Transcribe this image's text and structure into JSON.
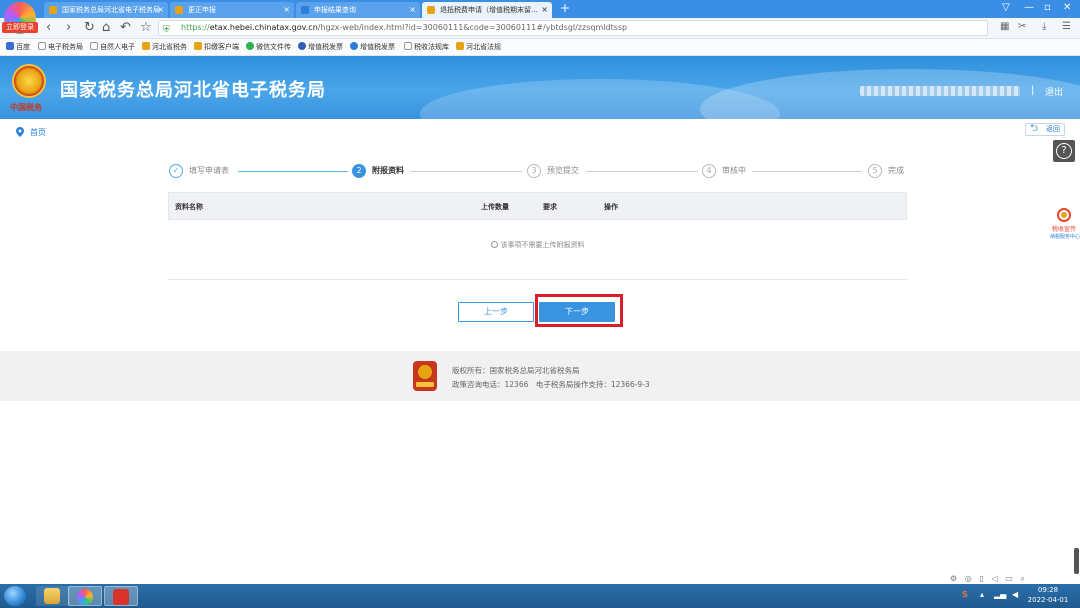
{
  "browser": {
    "badge": "立即登录",
    "tabs": [
      {
        "title": "国家税务总局河北省电子税务局",
        "active": false
      },
      {
        "title": "更正申报",
        "active": false
      },
      {
        "title": "申报结果查询",
        "active": false
      },
      {
        "title": "退抵税费申请（增值税期末留…",
        "active": true
      }
    ],
    "url_scheme": "https://",
    "url_host": "etax.hebei.chinatax.gov.cn",
    "url_path": "/hgzx-web/index.html?id=30060111&code=30060111#/ybtdsgl/zzsqmldtssp",
    "bookmarks": [
      "百度",
      "电子税务局",
      "自然人电子",
      "河北省税务",
      "扣缴客户端",
      "微信文件传",
      "增值税发票",
      "增值税发票",
      "税收法规库",
      "河北省法规"
    ]
  },
  "header": {
    "title": "国家税务总局河北省电子税务局",
    "emblem_text": "中国税务",
    "separator": "|",
    "logout": "退出"
  },
  "breadcrumb": {
    "home": "首页",
    "back": "返回",
    "help": "?"
  },
  "side_widget": {
    "name": "税收宣传",
    "sub": "纳税服务中心"
  },
  "steps": [
    {
      "num": "✓",
      "label": "填写申请表",
      "state": "done"
    },
    {
      "num": "2",
      "label": "附报资料",
      "state": "current"
    },
    {
      "num": "3",
      "label": "预览提交",
      "state": "todo"
    },
    {
      "num": "4",
      "label": "审核中",
      "state": "todo"
    },
    {
      "num": "5",
      "label": "完成",
      "state": "todo"
    }
  ],
  "table": {
    "columns": [
      "资料名称",
      "上传数量",
      "要求",
      "操作"
    ],
    "empty_text": "该事项不需要上传附报资料"
  },
  "buttons": {
    "prev": "上一步",
    "next": "下一步"
  },
  "footer": {
    "copyright": "版权所有：国家税务总局河北省税务局",
    "contact": "政策咨询电话：12366　电子税务局操作支持：12366-9-3"
  },
  "taskbar": {
    "time": "09:28",
    "date": "2022-04-01"
  },
  "colors": {
    "primary": "#3a93df",
    "highlight": "#d81e28",
    "header_bg": "#2e8fdc"
  }
}
